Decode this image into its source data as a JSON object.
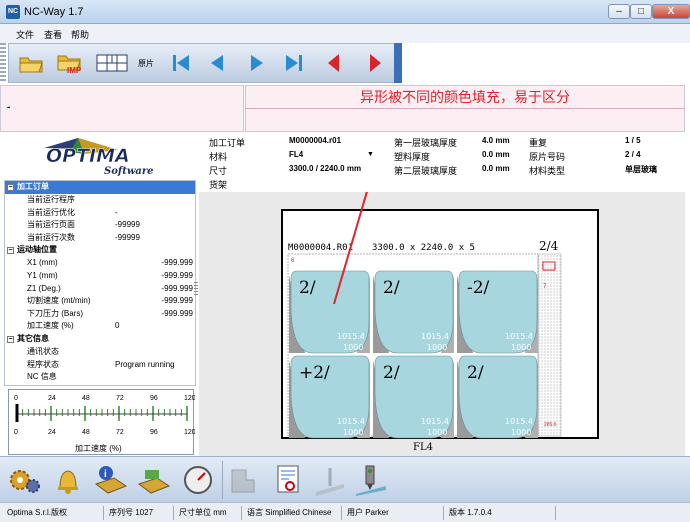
{
  "window": {
    "title": "NC-Way 1.7",
    "logo": "NC",
    "minimize": "–",
    "maximize": "□",
    "close": "X"
  },
  "menu": [
    "文件",
    "查看",
    "帮助"
  ],
  "toolbar": {
    "sheet_label": "原片",
    "imp_label": "IMP"
  },
  "banner_text": "异形被不同的颜色填充，易于区分",
  "info_left_mark": "-",
  "logo": {
    "word": "OPTIMA",
    "sub": "Software"
  },
  "tree": {
    "sections": [
      {
        "title": "加工订单",
        "expander": "−",
        "rows": [
          {
            "k": "当前运行程序",
            "v": "",
            "align": "left"
          },
          {
            "k": "当前运行优化",
            "v": "-",
            "align": "left"
          },
          {
            "k": "当前运行页面",
            "v": "-99999",
            "align": "left"
          },
          {
            "k": "当前运行次数",
            "v": "-99999",
            "align": "left"
          }
        ]
      },
      {
        "title": "运动轴位置",
        "expander": "−",
        "rows": [
          {
            "k": "X1 (mm)",
            "v": "-999.999",
            "align": "right"
          },
          {
            "k": "Y1 (mm)",
            "v": "-999.999",
            "align": "right"
          },
          {
            "k": "Z1 (Deg.)",
            "v": "-999.999",
            "align": "right"
          },
          {
            "k": "切割速度 (mt/min)",
            "v": "-999.999",
            "align": "right"
          },
          {
            "k": "下刀压力 (Bars)",
            "v": "-999.999",
            "align": "right"
          },
          {
            "k": "加工速度 (%)",
            "v": "0",
            "align": "left"
          }
        ]
      },
      {
        "title": "其它信息",
        "expander": "−",
        "rows": [
          {
            "k": "通讯状态",
            "v": "",
            "align": "left"
          },
          {
            "k": "程序状态",
            "v": "Program running",
            "align": "left"
          },
          {
            "k": "NC 信息",
            "v": "",
            "align": "left"
          }
        ]
      }
    ]
  },
  "gauge": {
    "ticks": [
      "0",
      "24",
      "48",
      "72",
      "96",
      "120"
    ],
    "caption": "加工速度 (%)",
    "value": 0
  },
  "props": {
    "col1": [
      {
        "label": "加工订单",
        "value": "M0000004.r01"
      },
      {
        "label": "材料",
        "value": "FL4"
      },
      {
        "label": "尺寸",
        "value": "3300.0 / 2240.0 mm"
      },
      {
        "label": "货架",
        "value": ""
      }
    ],
    "col2": [
      {
        "label": "第一层玻璃厚度",
        "value": "4.0 mm"
      },
      {
        "label": "塑料厚度",
        "value": "0.0 mm"
      },
      {
        "label": "第二层玻璃厚度",
        "value": "0.0 mm"
      }
    ],
    "col3": [
      {
        "label": "重复",
        "value": "1 / 5"
      },
      {
        "label": "原片号码",
        "value": "2 / 4"
      },
      {
        "label": "材料类型",
        "value": "单层玻璃"
      }
    ],
    "dropdown_arrow": "▼"
  },
  "sheet": {
    "header_order": "M0000004.R01",
    "header_dims": "3300.0 x  2240.0 x 5",
    "header_page": "2/4",
    "material": "FL4",
    "edge_mark_top": "6",
    "edge_mark_right": "7",
    "scrap_label": "285.6",
    "pieces": [
      {
        "label": "2/",
        "w": "1015.4",
        "h": "1000"
      },
      {
        "label": "2/",
        "w": "1015.4",
        "h": "1000"
      },
      {
        "label": "-2/",
        "w": "1015.4",
        "h": "1000"
      },
      {
        "label": "+2/",
        "w": "1015.4",
        "h": "1000"
      },
      {
        "label": "2/",
        "w": "1015.4",
        "h": "1000"
      },
      {
        "label": "2/",
        "w": "1015.4",
        "h": "1000"
      }
    ]
  },
  "colors": {
    "piece_fill": "#a7d6df",
    "banner_red": "#e0242b",
    "nav_blue": "#2a8bd1",
    "nav_red": "#d8242b",
    "selected": "#3a79d6"
  },
  "status": {
    "company": "Optima S.r.l.版权",
    "serial": "序列号 1027",
    "unit": "尺寸单位 mm",
    "language": "语言 Simplified Chinese",
    "user": "用户 Parker",
    "version": "版本 1.7.0.4"
  }
}
